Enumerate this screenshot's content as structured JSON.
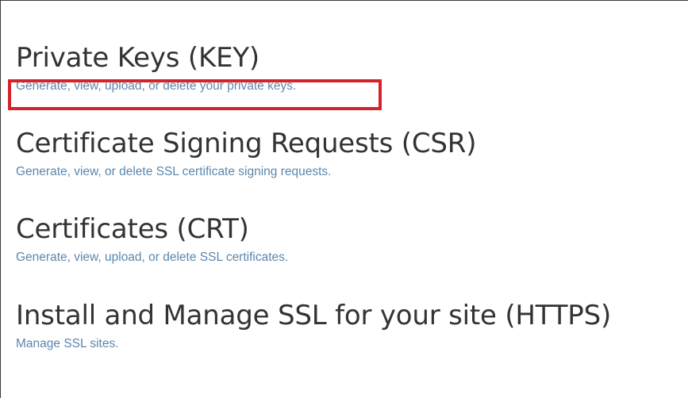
{
  "colors": {
    "title": "#333333",
    "link": "#5c87ad",
    "highlight": "#d4242b",
    "frame": "#3a3a3a"
  },
  "sections": [
    {
      "title": "Private Keys (KEY)",
      "link": "Generate, view, upload, or delete your private keys.",
      "highlighted": true
    },
    {
      "title": "Certificate Signing Requests (CSR)",
      "link": "Generate, view, or delete SSL certificate signing requests."
    },
    {
      "title": "Certificates (CRT)",
      "link": "Generate, view, upload, or delete SSL certificates."
    },
    {
      "title": "Install and Manage SSL for your site (HTTPS)",
      "link": "Manage SSL sites."
    }
  ]
}
